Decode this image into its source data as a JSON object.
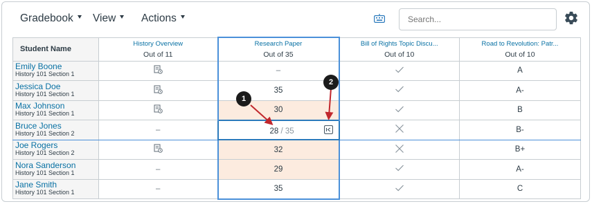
{
  "toolbar": {
    "gradebook_label": "Gradebook",
    "view_label": "View",
    "actions_label": "Actions",
    "search_placeholder": "Search..."
  },
  "grid": {
    "name_header": "Student Name",
    "columns": [
      {
        "title": "History Overview",
        "subtitle": "Out of 11"
      },
      {
        "title": "Research Paper",
        "subtitle": "Out of 35"
      },
      {
        "title": "Bill of Rights Topic Discu...",
        "subtitle": "Out of 10"
      },
      {
        "title": "Road to Revolution: Patr...",
        "subtitle": "Out of 10"
      }
    ],
    "rows": [
      {
        "name": "Emily Boone",
        "section": "History 101 Section 1",
        "history": "doc-icon",
        "paper": "–",
        "paper_late": false,
        "bill": "check",
        "road": "A"
      },
      {
        "name": "Jessica Doe",
        "section": "History 101 Section 1",
        "history": "doc-icon",
        "paper": "35",
        "paper_late": false,
        "bill": "check",
        "road": "A-"
      },
      {
        "name": "Max Johnson",
        "section": "History 101 Section 1",
        "history": "doc-icon",
        "paper": "30",
        "paper_late": true,
        "bill": "check",
        "road": "B"
      },
      {
        "name": "Bruce Jones",
        "section": "History 101 Section 2",
        "history": "–",
        "paper": "editing",
        "paper_late": false,
        "bill": "x",
        "road": "B-"
      },
      {
        "name": "Joe Rogers",
        "section": "History 101 Section 2",
        "history": "doc-icon",
        "paper": "32",
        "paper_late": true,
        "bill": "x",
        "road": "B+"
      },
      {
        "name": "Nora Sanderson",
        "section": "History 101 Section 1",
        "history": "–",
        "paper": "29",
        "paper_late": true,
        "bill": "check",
        "road": "A-"
      },
      {
        "name": "Jane Smith",
        "section": "History 101 Section 1",
        "history": "–",
        "paper": "35",
        "paper_late": false,
        "bill": "check",
        "road": "C"
      }
    ],
    "editing": {
      "value": "28",
      "out_of": "/ 35"
    }
  },
  "callouts": {
    "one": "1",
    "two": "2"
  },
  "colors": {
    "link": "#0770a3",
    "selection": "#2b7abc",
    "late_fill": "#fcebdf",
    "callout": "#1b1b1b",
    "arrow": "#c1272d"
  }
}
